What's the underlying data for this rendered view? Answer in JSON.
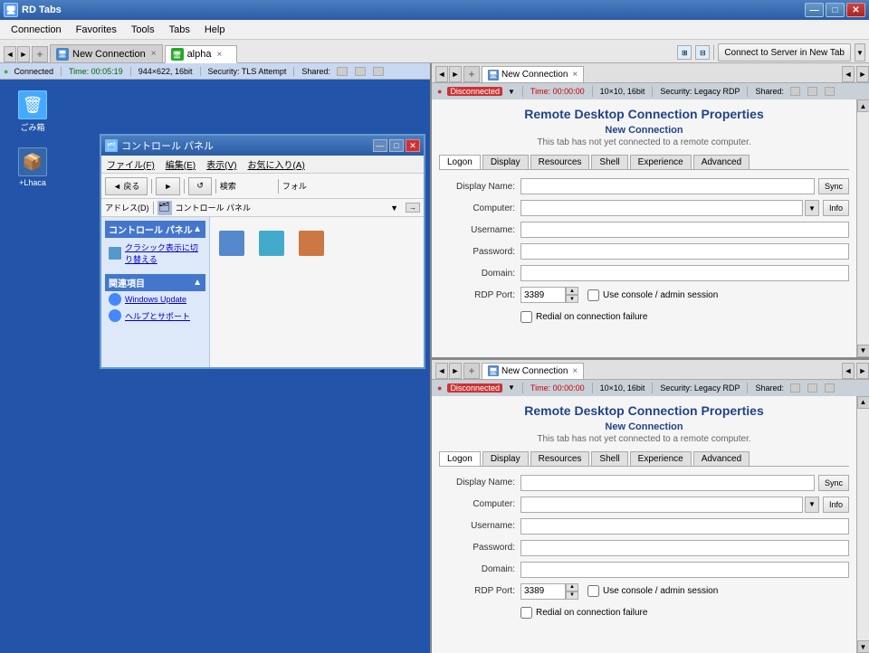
{
  "app": {
    "title": "RD Tabs",
    "icon": "🖥"
  },
  "titlebar": {
    "minimize": "—",
    "maximize": "□",
    "close": "✕"
  },
  "menu": {
    "items": [
      "Connection",
      "Favorites",
      "Tools",
      "Tabs",
      "Help"
    ]
  },
  "tabs": [
    {
      "label": "New Connection",
      "active": false,
      "close": "×"
    },
    {
      "label": "alpha",
      "active": true,
      "close": "×"
    }
  ],
  "top_toolbar": {
    "connect_server_btn": "Connect to Server in New Tab",
    "nav_left": "◄",
    "nav_right": "►"
  },
  "left_pane": {
    "status": {
      "dot": "●",
      "label": "Connected",
      "time": "Time: 00:05:19",
      "resolution": "944×622, 16bit",
      "security": "Security: TLS Attempt",
      "shared": "Shared:"
    },
    "tabs": [
      {
        "label": "New Connection",
        "active": false
      },
      {
        "label": "alpha",
        "active": true,
        "close": "×"
      }
    ],
    "desktop_icons": [
      {
        "label": "ごみ箱",
        "icon": "🗑"
      },
      {
        "label": "+Lhaca",
        "icon": "📦"
      }
    ]
  },
  "control_panel": {
    "title": "コントロール パネル",
    "menu": [
      "ファイル(F)",
      "編集(E)",
      "表示(V)",
      "お気に入り(A)"
    ],
    "back_btn": "◄ 戻る",
    "forward_btn": "►",
    "search_placeholder": "検索",
    "folder_btn": "フォル",
    "address_label": "アドレス(D)",
    "address_value": "コントロール パネル",
    "sidebar_title": "コントロール パネル",
    "sidebar_arrow": "▲",
    "sidebar_item": "クラシック表示に切り替える",
    "related_title": "関連項目",
    "related_arrow": "▲",
    "related_items": [
      "Windows Update",
      "ヘルプとサポート"
    ]
  },
  "right_panels": [
    {
      "id": "panel1",
      "tab_label": "New Connection",
      "tab_close": "×",
      "status": {
        "label": "Disconnected",
        "time": "Time: 00:00:00",
        "resolution": "10×10, 16bit",
        "security": "Security: Legacy RDP",
        "shared": "Shared:"
      },
      "rdp": {
        "title": "Remote Desktop Connection Properties",
        "subtitle": "New Connection",
        "description": "This tab has not yet connected to a remote computer.",
        "tabs": [
          "Logon",
          "Display",
          "Resources",
          "Shell",
          "Experience",
          "Advanced"
        ],
        "active_tab": "Logon",
        "fields": {
          "display_name_label": "Display Name:",
          "computer_label": "Computer:",
          "username_label": "Username:",
          "password_label": "Password:",
          "domain_label": "Domain:",
          "rdp_port_label": "RDP Port:",
          "rdp_port_value": "3389"
        },
        "buttons": {
          "sync": "Sync",
          "info": "Info"
        },
        "checkboxes": {
          "console": "Use console / admin session",
          "redial": "Redial on connection failure"
        }
      }
    },
    {
      "id": "panel2",
      "tab_label": "New Connection",
      "tab_close": "×",
      "status": {
        "label": "Disconnected",
        "time": "Time: 00:00:00",
        "resolution": "10×10, 16bit",
        "security": "Security: Legacy RDP",
        "shared": "Shared:"
      },
      "rdp": {
        "title": "Remote Desktop Connection Properties",
        "subtitle": "New Connection",
        "description": "This tab has not yet connected to a remote computer.",
        "tabs": [
          "Logon",
          "Display",
          "Resources",
          "Shell",
          "Experience",
          "Advanced"
        ],
        "active_tab": "Logon",
        "fields": {
          "display_name_label": "Display Name:",
          "computer_label": "Computer:",
          "username_label": "Username:",
          "password_label": "Password:",
          "domain_label": "Domain:",
          "rdp_port_label": "RDP Port:",
          "rdp_port_value": "3389"
        },
        "buttons": {
          "sync": "Sync",
          "info": "Info"
        },
        "checkboxes": {
          "console": "Use console / admin session",
          "redial": "Redial on connection failure"
        }
      }
    }
  ],
  "colors": {
    "connected": "#44aa44",
    "disconnected": "#cc3333",
    "title_bg": "#2a5ba3",
    "desktop_bg": "#2255aa"
  }
}
